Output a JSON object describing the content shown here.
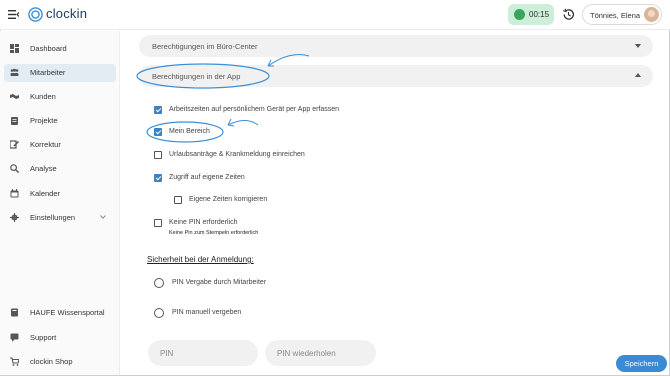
{
  "app": {
    "logo": "clockin"
  },
  "topbar": {
    "timer": "00:15",
    "user_name": "Tönnies, Elena"
  },
  "sidebar": {
    "items": [
      {
        "label": "Dashboard",
        "icon": "dashboard-icon"
      },
      {
        "label": "Mitarbeiter",
        "icon": "users-icon",
        "active": true
      },
      {
        "label": "Kunden",
        "icon": "handshake-icon"
      },
      {
        "label": "Projekte",
        "icon": "clipboard-icon"
      },
      {
        "label": "Korrektur",
        "icon": "edit-icon"
      },
      {
        "label": "Analyse",
        "icon": "search-chart-icon"
      },
      {
        "label": "Kalender",
        "icon": "calendar-icon"
      },
      {
        "label": "Einstellungen",
        "icon": "gear-icon"
      }
    ],
    "bottom_items": [
      {
        "label": "HAUFE Wissensportal",
        "icon": "book-icon"
      },
      {
        "label": "Support",
        "icon": "support-icon"
      },
      {
        "label": "clockin Shop",
        "icon": "cart-icon"
      }
    ]
  },
  "main": {
    "accordion_buero": "Berechtigungen im Büro-Center",
    "accordion_app": "Berechtigungen in der App",
    "permissions": [
      {
        "label": "Arbeitszeiten auf persönlichem Gerät per App erfassen",
        "checked": true
      },
      {
        "label": "Mein Bereich",
        "checked": true
      },
      {
        "label": "Urlaubsanträge & Krankmeldung einreichen",
        "checked": false
      },
      {
        "label": "Zugriff auf eigene Zeiten",
        "checked": true
      },
      {
        "label": "Eigene Zeiten korrigieren",
        "checked": false
      },
      {
        "label": "Keine PIN erforderlich",
        "checked": false,
        "sub": "Keine Pin zum Stempeln erforderlich"
      }
    ],
    "security_title": "Sicherheit bei der Anmeldung:",
    "radios": [
      {
        "label": "PIN Vergabe durch Mitarbeiter"
      },
      {
        "label": "PIN manuell vergeben"
      }
    ],
    "pin_placeholder": "PIN",
    "pin_repeat_placeholder": "PIN wiederholen",
    "save_label": "Speichern"
  },
  "colors": {
    "accent": "#3b82c4",
    "timer_bg": "#cdeed8",
    "annotation": "#3a8fd6"
  }
}
